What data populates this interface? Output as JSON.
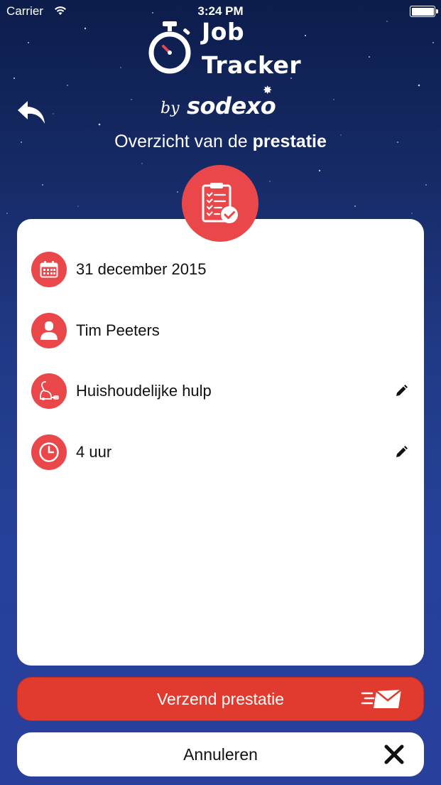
{
  "status_bar": {
    "carrier": "Carrier",
    "time": "3:24 PM"
  },
  "logo": {
    "line1": "Job",
    "line2": "Tracker",
    "by": "by",
    "brand": "sodexo"
  },
  "page_title": {
    "normal": "Overzicht van de ",
    "bold": "prestatie"
  },
  "details": {
    "date": "31 december 2015",
    "person": "Tim Peeters",
    "service": "Huishoudelijke hulp",
    "duration": "4 uur"
  },
  "actions": {
    "send_label": "Verzend prestatie",
    "cancel_label": "Annuleren"
  },
  "colors": {
    "accent": "#e9474a",
    "send_button": "#e13a2e",
    "background_top": "#0c1d4b",
    "background_bottom": "#283f9c"
  },
  "icons": {
    "back": "back-arrow-icon",
    "badge": "clipboard-check-icon",
    "date": "calendar-icon",
    "person": "person-icon",
    "service": "vacuum-cleaner-icon",
    "duration": "clock-icon",
    "edit": "pencil-icon",
    "send": "envelope-send-icon",
    "cancel": "close-icon"
  }
}
